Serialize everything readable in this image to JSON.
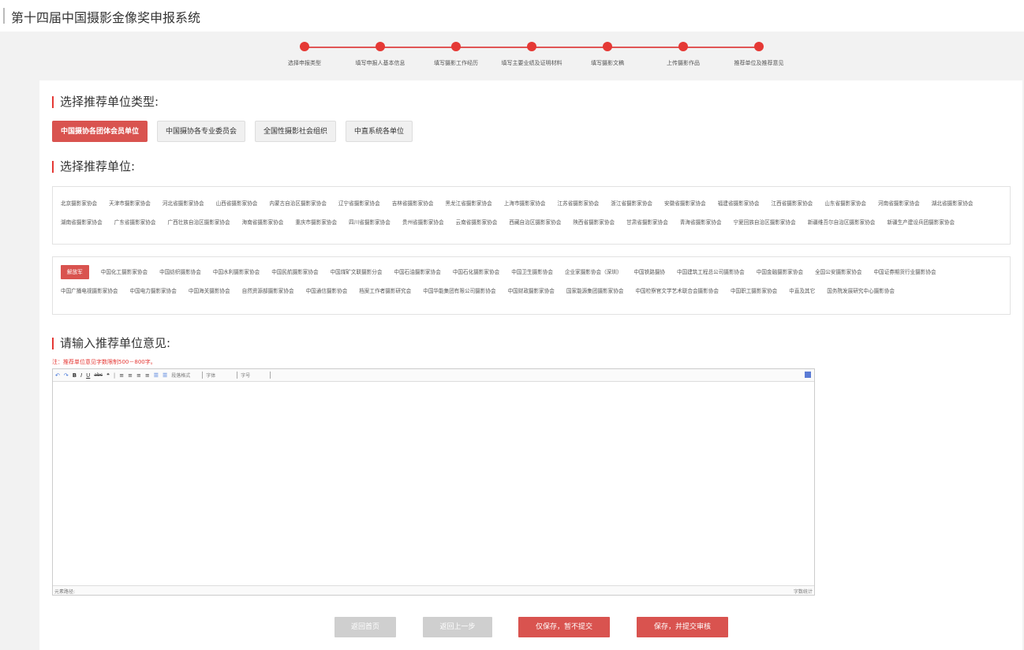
{
  "header": {
    "title": "第十四届中国摄影金像奖申报系统"
  },
  "steps": [
    "选择申报类型",
    "填写申报人基本信息",
    "填写摄影工作经历",
    "填写主要业绩及证明材料",
    "填写摄影文稿",
    "上传摄影作品",
    "推荐单位及推荐意见"
  ],
  "section_type": {
    "title": "选择推荐单位类型:"
  },
  "unit_types": [
    {
      "label": "中国摄协各团体会员单位",
      "active": true
    },
    {
      "label": "中国摄协各专业委员会",
      "active": false
    },
    {
      "label": "全国性摄影社会组织",
      "active": false
    },
    {
      "label": "中直系统各单位",
      "active": false
    }
  ],
  "section_unit": {
    "title": "选择推荐单位:"
  },
  "provincial_units": [
    "北京摄影家协会",
    "天津市摄影家协会",
    "河北省摄影家协会",
    "山西省摄影家协会",
    "内蒙古自治区摄影家协会",
    "辽宁省摄影家协会",
    "吉林省摄影家协会",
    "黑龙江省摄影家协会",
    "上海市摄影家协会",
    "江苏省摄影家协会",
    "浙江省摄影家协会",
    "安徽省摄影家协会",
    "福建省摄影家协会",
    "江西省摄影家协会",
    "山东省摄影家协会",
    "河南省摄影家协会",
    "湖北省摄影家协会",
    "湖南省摄影家协会",
    "广东省摄影家协会",
    "广西壮族自治区摄影家协会",
    "海南省摄影家协会",
    "重庆市摄影家协会",
    "四川省摄影家协会",
    "贵州省摄影家协会",
    "云南省摄影家协会",
    "西藏自治区摄影家协会",
    "陕西省摄影家协会",
    "甘肃省摄影家协会",
    "青海省摄影家协会",
    "宁夏回族自治区摄影家协会",
    "新疆维吾尔自治区摄影家协会",
    "新疆生产建设兵团摄影家协会"
  ],
  "industry_units": [
    {
      "label": "解放军",
      "active": true
    },
    {
      "label": "中国化工摄影家协会"
    },
    {
      "label": "中国纺织摄影协会"
    },
    {
      "label": "中国水利摄影家协会"
    },
    {
      "label": "中国民航摄影家协会"
    },
    {
      "label": "中国煤矿文联摄影分会"
    },
    {
      "label": "中国石油摄影家协会"
    },
    {
      "label": "中国石化摄影家协会"
    },
    {
      "label": "中国卫生摄影协会"
    },
    {
      "label": "企业家摄影协会（深圳）"
    },
    {
      "label": "中国铁路摄协"
    },
    {
      "label": "中国建筑工程总公司摄影协会"
    },
    {
      "label": "中国金融摄影家协会"
    },
    {
      "label": "全国公安摄影家协会"
    },
    {
      "label": "中国证券期货行业摄影协会"
    },
    {
      "label": "中国广播电视摄影家协会"
    },
    {
      "label": "中国电力摄影家协会"
    },
    {
      "label": "中国海关摄影协会"
    },
    {
      "label": "自然资源部摄影家协会"
    },
    {
      "label": "中国通信摄影协会"
    },
    {
      "label": "档案工作者摄影研究会"
    },
    {
      "label": "中国华能集团有限公司摄影协会"
    },
    {
      "label": "中国财政摄影家协会"
    },
    {
      "label": "国家能源集团摄影家协会"
    },
    {
      "label": "中国检察官文学艺术联合会摄影协会"
    },
    {
      "label": "中国职工摄影家协会"
    },
    {
      "label": "中直及其它"
    },
    {
      "label": "国务院发展研究中心摄影协会"
    }
  ],
  "section_opinion": {
    "title": "请输入推荐单位意见:"
  },
  "note": "注：推荐单位意见字数限制500－800字。",
  "editor": {
    "toolbar": [
      "↶",
      "↷",
      "B",
      "I",
      "U",
      "abc",
      "❝"
    ],
    "align": [
      "≡",
      "≡",
      "≡",
      "≡"
    ],
    "lists": [
      "☰",
      "☰"
    ],
    "selects": [
      "段落格式",
      "字体",
      "字号"
    ],
    "status_left": "元素路径:",
    "status_right": "字数统计"
  },
  "buttons": {
    "home": "返回首页",
    "prev": "返回上一步",
    "save": "仅保存，暂不提交",
    "submit": "保存，并提交审核"
  }
}
